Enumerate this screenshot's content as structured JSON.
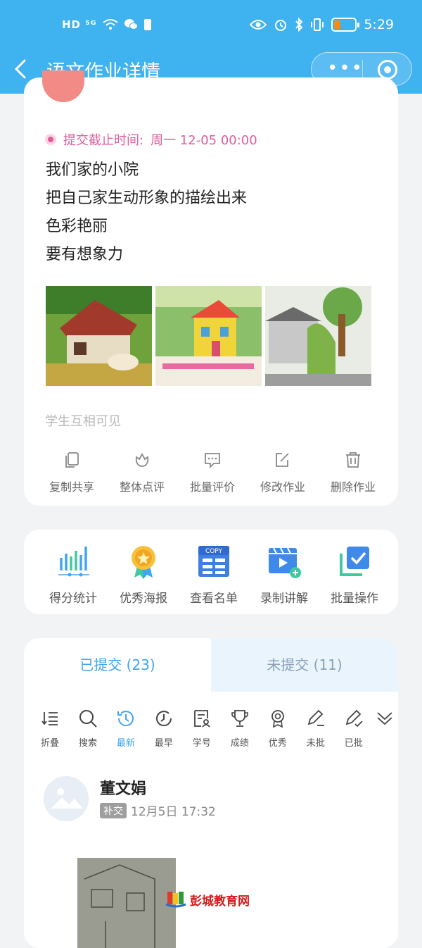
{
  "status_bar": {
    "left": "HD ⁵ᴳ",
    "time": "5:29"
  },
  "nav": {
    "back": "<",
    "title": "语文作业详情"
  },
  "card1": {
    "deadline_label": "提交截止时间:",
    "deadline_value": "周一 12-05 00:00",
    "content": [
      "我们家的小院",
      "把自己家生动形象的描绘出来",
      "色彩艳丽",
      "要有想象力"
    ],
    "visibility": "学生互相可见",
    "actions": [
      {
        "label": "复制共享",
        "icon": "copy-icon"
      },
      {
        "label": "整体点评",
        "icon": "flower-icon"
      },
      {
        "label": "批量评价",
        "icon": "comment-icon"
      },
      {
        "label": "修改作业",
        "icon": "edit-icon"
      },
      {
        "label": "删除作业",
        "icon": "trash-icon"
      }
    ]
  },
  "card2": {
    "tools": [
      {
        "label": "得分统计",
        "icon": "chart-icon"
      },
      {
        "label": "优秀海报",
        "icon": "medal-icon"
      },
      {
        "label": "查看名单",
        "icon": "copy-list-icon"
      },
      {
        "label": "录制讲解",
        "icon": "video-icon"
      },
      {
        "label": "批量操作",
        "icon": "check-icon"
      }
    ]
  },
  "submissions": {
    "tabs": [
      {
        "label": "已提交 (23)"
      },
      {
        "label": "未提交 (11)"
      }
    ],
    "filters": [
      {
        "label": "折叠",
        "icon": "fold-icon"
      },
      {
        "label": "搜索",
        "icon": "search-icon"
      },
      {
        "label": "最新",
        "icon": "clock-icon"
      },
      {
        "label": "最早",
        "icon": "clock-back-icon"
      },
      {
        "label": "学号",
        "icon": "id-icon"
      },
      {
        "label": "成绩",
        "icon": "trophy-icon"
      },
      {
        "label": "优秀",
        "icon": "award-icon"
      },
      {
        "label": "未批",
        "icon": "pen-icon"
      },
      {
        "label": "已批",
        "icon": "pen-check-icon"
      }
    ],
    "student": {
      "name": "董文娟",
      "tag": "补交",
      "time": "12月5日 17:32"
    }
  },
  "watermark": "彭城教育网",
  "colors": {
    "accent": "#3fb2f0",
    "active": "#3fa5ef",
    "deadline": "#e05d9b"
  }
}
